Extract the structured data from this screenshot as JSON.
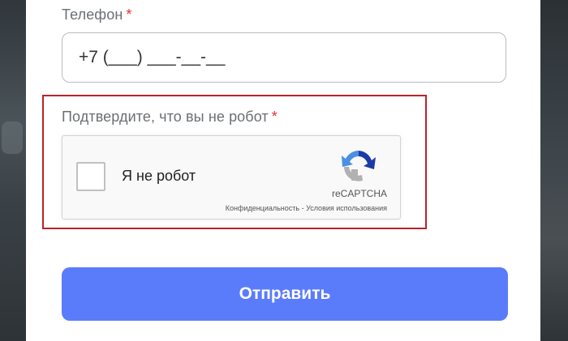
{
  "phone": {
    "label": "Телефон",
    "required_mark": "*",
    "value": "+7 (___) ___-__-__"
  },
  "captcha": {
    "label": "Подтвердите, что вы не робот",
    "required_mark": "*",
    "checkbox_label": "Я не робот",
    "checked": false,
    "brand": "reCAPTCHA",
    "privacy_link": "Конфиденциальность",
    "separator": " - ",
    "terms_link": "Условия использования"
  },
  "submit": {
    "label": "Отправить"
  },
  "colors": {
    "accent": "#5b7cfa",
    "required": "#e5322d",
    "error_border": "#b8232a"
  }
}
